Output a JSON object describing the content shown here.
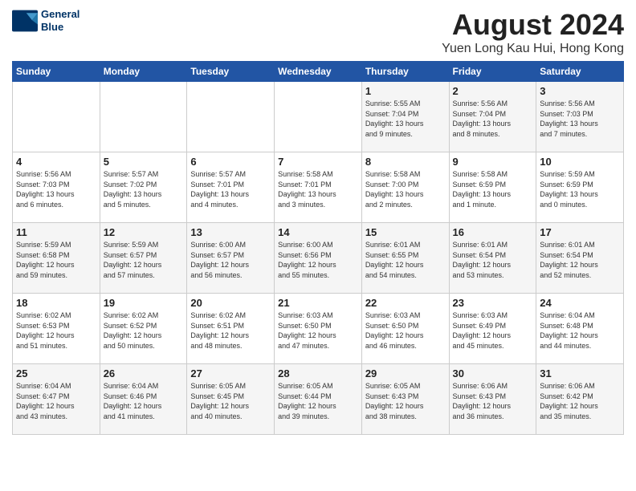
{
  "header": {
    "logo_line1": "General",
    "logo_line2": "Blue",
    "main_title": "August 2024",
    "subtitle": "Yuen Long Kau Hui, Hong Kong"
  },
  "days_of_week": [
    "Sunday",
    "Monday",
    "Tuesday",
    "Wednesday",
    "Thursday",
    "Friday",
    "Saturday"
  ],
  "weeks": [
    {
      "days": [
        {
          "num": "",
          "detail": ""
        },
        {
          "num": "",
          "detail": ""
        },
        {
          "num": "",
          "detail": ""
        },
        {
          "num": "",
          "detail": ""
        },
        {
          "num": "1",
          "detail": "Sunrise: 5:55 AM\nSunset: 7:04 PM\nDaylight: 13 hours\nand 9 minutes."
        },
        {
          "num": "2",
          "detail": "Sunrise: 5:56 AM\nSunset: 7:04 PM\nDaylight: 13 hours\nand 8 minutes."
        },
        {
          "num": "3",
          "detail": "Sunrise: 5:56 AM\nSunset: 7:03 PM\nDaylight: 13 hours\nand 7 minutes."
        }
      ]
    },
    {
      "days": [
        {
          "num": "4",
          "detail": "Sunrise: 5:56 AM\nSunset: 7:03 PM\nDaylight: 13 hours\nand 6 minutes."
        },
        {
          "num": "5",
          "detail": "Sunrise: 5:57 AM\nSunset: 7:02 PM\nDaylight: 13 hours\nand 5 minutes."
        },
        {
          "num": "6",
          "detail": "Sunrise: 5:57 AM\nSunset: 7:01 PM\nDaylight: 13 hours\nand 4 minutes."
        },
        {
          "num": "7",
          "detail": "Sunrise: 5:58 AM\nSunset: 7:01 PM\nDaylight: 13 hours\nand 3 minutes."
        },
        {
          "num": "8",
          "detail": "Sunrise: 5:58 AM\nSunset: 7:00 PM\nDaylight: 13 hours\nand 2 minutes."
        },
        {
          "num": "9",
          "detail": "Sunrise: 5:58 AM\nSunset: 6:59 PM\nDaylight: 13 hours\nand 1 minute."
        },
        {
          "num": "10",
          "detail": "Sunrise: 5:59 AM\nSunset: 6:59 PM\nDaylight: 13 hours\nand 0 minutes."
        }
      ]
    },
    {
      "days": [
        {
          "num": "11",
          "detail": "Sunrise: 5:59 AM\nSunset: 6:58 PM\nDaylight: 12 hours\nand 59 minutes."
        },
        {
          "num": "12",
          "detail": "Sunrise: 5:59 AM\nSunset: 6:57 PM\nDaylight: 12 hours\nand 57 minutes."
        },
        {
          "num": "13",
          "detail": "Sunrise: 6:00 AM\nSunset: 6:57 PM\nDaylight: 12 hours\nand 56 minutes."
        },
        {
          "num": "14",
          "detail": "Sunrise: 6:00 AM\nSunset: 6:56 PM\nDaylight: 12 hours\nand 55 minutes."
        },
        {
          "num": "15",
          "detail": "Sunrise: 6:01 AM\nSunset: 6:55 PM\nDaylight: 12 hours\nand 54 minutes."
        },
        {
          "num": "16",
          "detail": "Sunrise: 6:01 AM\nSunset: 6:54 PM\nDaylight: 12 hours\nand 53 minutes."
        },
        {
          "num": "17",
          "detail": "Sunrise: 6:01 AM\nSunset: 6:54 PM\nDaylight: 12 hours\nand 52 minutes."
        }
      ]
    },
    {
      "days": [
        {
          "num": "18",
          "detail": "Sunrise: 6:02 AM\nSunset: 6:53 PM\nDaylight: 12 hours\nand 51 minutes."
        },
        {
          "num": "19",
          "detail": "Sunrise: 6:02 AM\nSunset: 6:52 PM\nDaylight: 12 hours\nand 50 minutes."
        },
        {
          "num": "20",
          "detail": "Sunrise: 6:02 AM\nSunset: 6:51 PM\nDaylight: 12 hours\nand 48 minutes."
        },
        {
          "num": "21",
          "detail": "Sunrise: 6:03 AM\nSunset: 6:50 PM\nDaylight: 12 hours\nand 47 minutes."
        },
        {
          "num": "22",
          "detail": "Sunrise: 6:03 AM\nSunset: 6:50 PM\nDaylight: 12 hours\nand 46 minutes."
        },
        {
          "num": "23",
          "detail": "Sunrise: 6:03 AM\nSunset: 6:49 PM\nDaylight: 12 hours\nand 45 minutes."
        },
        {
          "num": "24",
          "detail": "Sunrise: 6:04 AM\nSunset: 6:48 PM\nDaylight: 12 hours\nand 44 minutes."
        }
      ]
    },
    {
      "days": [
        {
          "num": "25",
          "detail": "Sunrise: 6:04 AM\nSunset: 6:47 PM\nDaylight: 12 hours\nand 43 minutes."
        },
        {
          "num": "26",
          "detail": "Sunrise: 6:04 AM\nSunset: 6:46 PM\nDaylight: 12 hours\nand 41 minutes."
        },
        {
          "num": "27",
          "detail": "Sunrise: 6:05 AM\nSunset: 6:45 PM\nDaylight: 12 hours\nand 40 minutes."
        },
        {
          "num": "28",
          "detail": "Sunrise: 6:05 AM\nSunset: 6:44 PM\nDaylight: 12 hours\nand 39 minutes."
        },
        {
          "num": "29",
          "detail": "Sunrise: 6:05 AM\nSunset: 6:43 PM\nDaylight: 12 hours\nand 38 minutes."
        },
        {
          "num": "30",
          "detail": "Sunrise: 6:06 AM\nSunset: 6:43 PM\nDaylight: 12 hours\nand 36 minutes."
        },
        {
          "num": "31",
          "detail": "Sunrise: 6:06 AM\nSunset: 6:42 PM\nDaylight: 12 hours\nand 35 minutes."
        }
      ]
    }
  ]
}
